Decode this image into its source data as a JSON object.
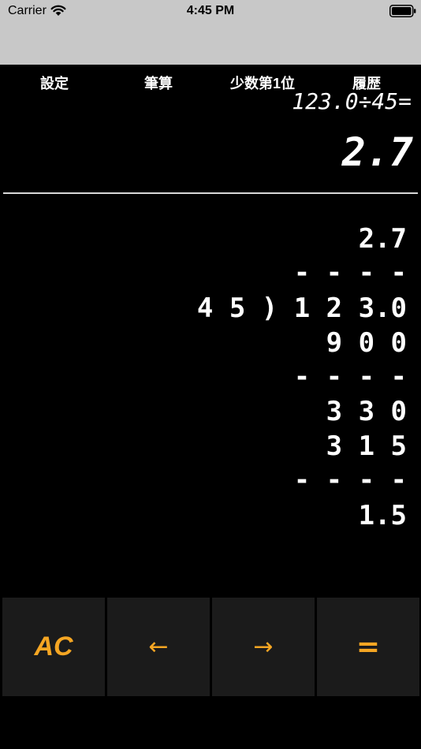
{
  "status_bar": {
    "carrier": "Carrier",
    "time": "4:45 PM",
    "wifi_icon": "wifi-icon",
    "battery_icon": "battery-full-icon"
  },
  "menu": {
    "settings": "設定",
    "long_division": "筆算",
    "decimal_place": "少数第1位",
    "history": "履歴"
  },
  "display": {
    "expression": "123.0÷45=",
    "result": "2.7"
  },
  "long_division": {
    "rows": [
      "2.7",
      "- - - -",
      "4 5 ) 1 2 3.0",
      "9 0 0",
      "- - - -",
      "3 3 0",
      "3 1 5",
      "- - - -",
      "1.5"
    ]
  },
  "keypad": {
    "clear": "AC",
    "left": "←",
    "right": "→",
    "equals": "="
  },
  "colors": {
    "accent": "#f5a623",
    "background": "#000000",
    "key_background": "#1b1b1b",
    "status_bar": "#c8c8c8"
  }
}
